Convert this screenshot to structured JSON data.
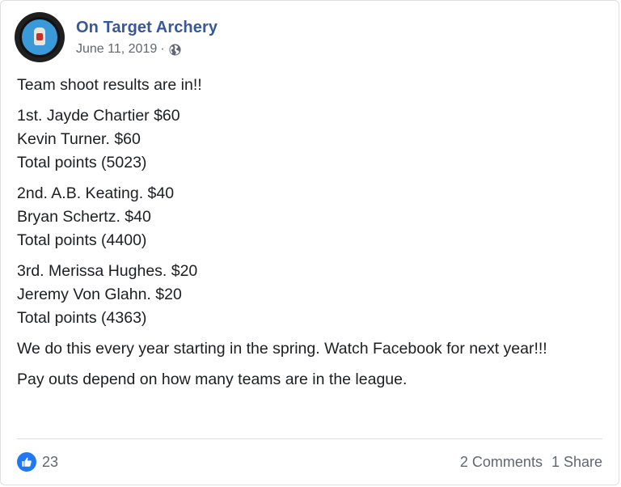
{
  "post": {
    "author": "On Target Archery",
    "date": "June 11, 2019",
    "separator": "·",
    "privacy_icon": "globe-icon",
    "avatar": {
      "word_top": "On Target",
      "word_bottom": "Archery"
    },
    "paragraphs": [
      [
        "Team shoot results are in!!"
      ],
      [
        "1st. Jayde Chartier $60",
        "Kevin Turner. $60",
        "Total points (5023)"
      ],
      [
        "2nd. A.B. Keating. $40",
        "Bryan Schertz. $40",
        "Total points (4400)"
      ],
      [
        "3rd. Merissa Hughes. $20",
        "Jeremy Von Glahn. $20",
        "Total points (4363)"
      ],
      [
        "We do this every year starting in the spring. Watch Facebook for next year!!!"
      ],
      [
        "Pay outs depend on how many teams are in the league."
      ]
    ]
  },
  "footer": {
    "reaction_icon": "like-icon",
    "reaction_count": "23",
    "comments": "2 Comments",
    "shares": "1 Share"
  },
  "colors": {
    "brand_link": "#385898",
    "like_blue": "#2078f4",
    "muted": "#606770"
  }
}
